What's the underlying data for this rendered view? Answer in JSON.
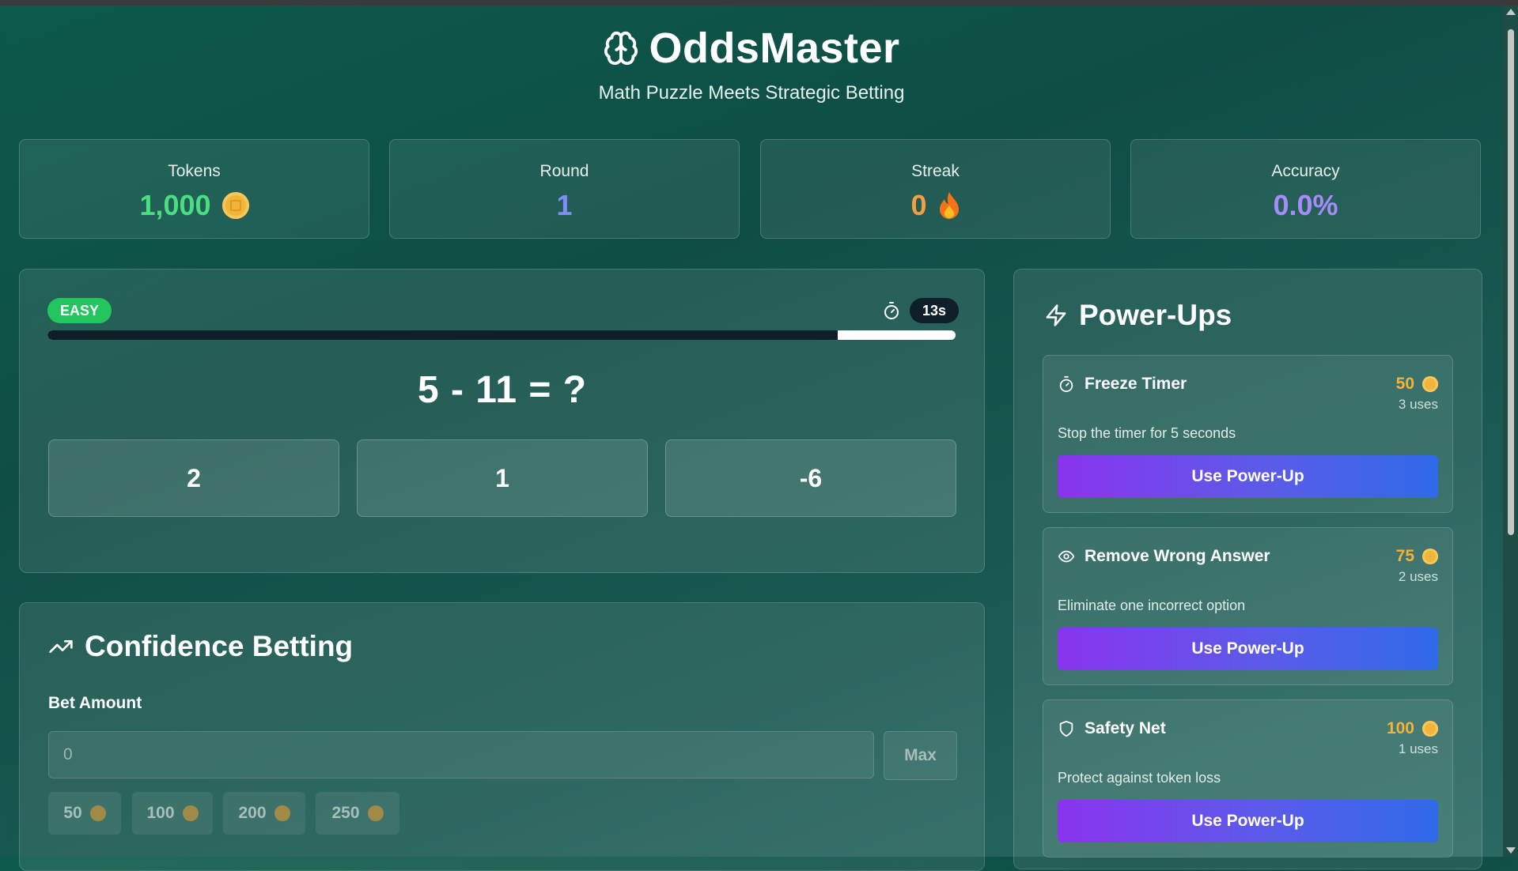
{
  "app": {
    "title": "OddsMaster",
    "subtitle": "Math Puzzle Meets Strategic Betting",
    "logo_icon": "brain-icon"
  },
  "stats": [
    {
      "label": "Tokens",
      "value": "1,000",
      "color": "#4ade80",
      "icon": "coin-icon"
    },
    {
      "label": "Round",
      "value": "1",
      "color": "#818cf8"
    },
    {
      "label": "Streak",
      "value": "0",
      "color": "#f59e42",
      "icon": "flame-icon"
    },
    {
      "label": "Accuracy",
      "value": "0.0%",
      "color": "#a78bfa"
    }
  ],
  "puzzle": {
    "difficulty": "EASY",
    "timer": "13s",
    "time_remaining_fraction": 0.13,
    "question": "5 - 11 = ?",
    "answers": [
      "2",
      "1",
      "-6"
    ]
  },
  "betting": {
    "title": "Confidence Betting",
    "bet_label": "Bet Amount",
    "placeholder": "0",
    "max_label": "Max",
    "quick_bets": [
      "50",
      "100",
      "200",
      "250"
    ]
  },
  "powerups": {
    "title": "Power-Ups",
    "items": [
      {
        "name": "Freeze Timer",
        "icon": "stopwatch-icon",
        "cost": "50",
        "uses": "3 uses",
        "description": "Stop the timer for 5 seconds",
        "button": "Use Power-Up"
      },
      {
        "name": "Remove Wrong Answer",
        "icon": "eye-icon",
        "cost": "75",
        "uses": "2 uses",
        "description": "Eliminate one incorrect option",
        "button": "Use Power-Up"
      },
      {
        "name": "Safety Net",
        "icon": "shield-icon",
        "cost": "100",
        "uses": "1 uses",
        "description": "Protect against token loss",
        "button": "Use Power-Up"
      }
    ]
  },
  "colors": {
    "accent_green": "#22c55e",
    "accent_gold": "#f5b23b",
    "button_gradient_start": "#8a34ef",
    "button_gradient_end": "#2f6ae8"
  }
}
